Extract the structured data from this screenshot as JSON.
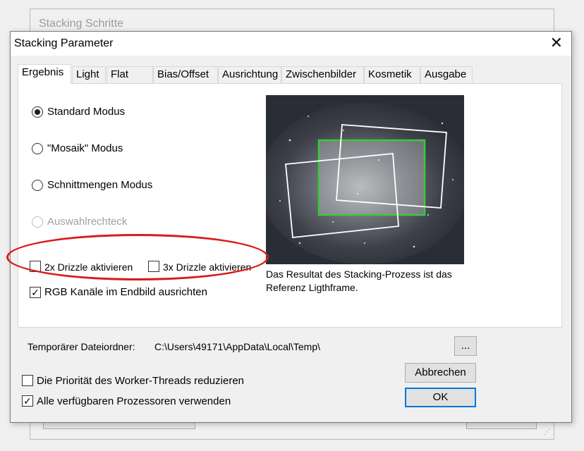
{
  "background_window": {
    "title": "Stacking Schritte"
  },
  "dialog": {
    "title": "Stacking Parameter",
    "close_glyph": "✕",
    "tabs": [
      {
        "label": "Ergebnis",
        "active": true
      },
      {
        "label": "Light"
      },
      {
        "label": "Flat"
      },
      {
        "label": "Bias/Offset"
      },
      {
        "label": "Ausrichtung"
      },
      {
        "label": "Zwischenbilder"
      },
      {
        "label": "Kosmetik"
      },
      {
        "label": "Ausgabe"
      }
    ],
    "modes": {
      "standard": "Standard Modus",
      "mosaik": "\"Mosaik\" Modus",
      "schnittmengen": "Schnittmengen Modus",
      "auswahl": "Auswahlrechteck",
      "selected": "standard"
    },
    "drizzle": {
      "x2": "2x Drizzle aktivieren",
      "x3": "3x Drizzle aktivieren",
      "x2_checked": false,
      "x3_checked": false
    },
    "rgb_align": {
      "label": "RGB Kanäle im Endbild ausrichten",
      "checked": true
    },
    "preview_caption": {
      "line1": "Das Resultat des Stacking-Prozess ist das",
      "line2": "Referenz Ligthframe."
    },
    "temp_folder": {
      "label": "Temporärer Dateiordner:",
      "path": "C:\\Users\\49171\\AppData\\Local\\Temp\\",
      "browse_label": "..."
    },
    "worker_priority": {
      "label": "Die Priorität des Worker-Threads reduzieren",
      "checked": false
    },
    "all_processors": {
      "label": "Alle verfügbaren Prozessoren verwenden",
      "checked": true
    },
    "buttons": {
      "cancel": "Abbrechen",
      "ok": "OK"
    }
  },
  "colors": {
    "highlight_ellipse": "#d81c1c",
    "reference_frame": "#3cc83c",
    "default_button_border": "#0078d7"
  }
}
